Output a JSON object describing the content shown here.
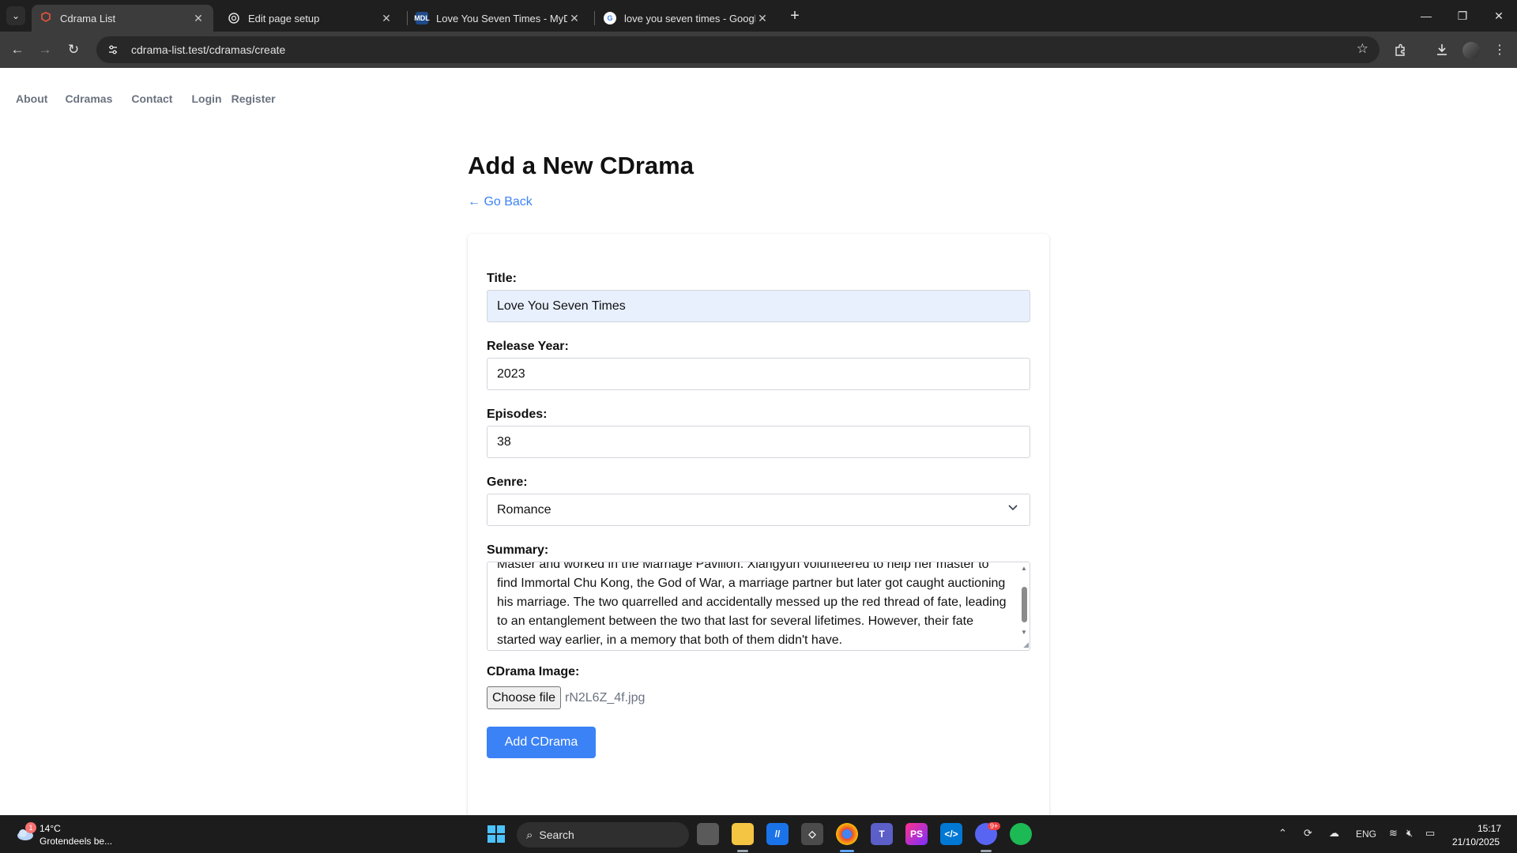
{
  "browser": {
    "tabs": [
      {
        "title": "Cdrama List",
        "active": true,
        "favicon": "laravel-icon"
      },
      {
        "title": "Edit page setup",
        "active": false,
        "favicon": "openai-icon"
      },
      {
        "title": "Love You Seven Times - MyDra",
        "active": false,
        "favicon": "mdl-icon",
        "favicon_text": "MDL"
      },
      {
        "title": "love you seven times - Google",
        "active": false,
        "favicon": "google-icon",
        "favicon_text": "G"
      }
    ],
    "url": "cdrama-list.test/cdramas/create"
  },
  "nav": {
    "about": "About",
    "cdramas": "Cdramas",
    "contact": "Contact",
    "login": "Login",
    "register": "Register"
  },
  "page": {
    "title": "Add a New CDrama",
    "go_back": "← Go Back"
  },
  "form": {
    "title_label": "Title:",
    "title_value": "Love You Seven Times",
    "year_label": "Release Year:",
    "year_value": "2023",
    "episodes_label": "Episodes:",
    "episodes_value": "38",
    "genre_label": "Genre:",
    "genre_value": "Romance",
    "summary_label": "Summary:",
    "summary_value": "Master and worked in the Marriage Pavilion. Xiangyun volunteered to help her master to find Immortal Chu Kong, the God of War, a marriage partner but later got caught auctioning his marriage. The two quarrelled and accidentally messed up the red thread of fate, leading to an entanglement between the two that last for several lifetimes. However, their fate started way earlier, in a memory that both of them didn't have.",
    "image_label": "CDrama Image:",
    "choose_file": "Choose file",
    "file_name": "rN2L6Z_4f.jpg",
    "submit": "Add CDrama"
  },
  "taskbar": {
    "weather_temp": "14°C",
    "weather_desc": "Grotendeels be...",
    "weather_badge": "1",
    "search": "Search",
    "language": "ENG",
    "time": "15:17",
    "date": "21/10/2025",
    "discord_badge": "9+"
  },
  "colors": {
    "accent": "#3b82f6",
    "autofill": "#e8f0fe",
    "nav_text": "#6b7280"
  }
}
